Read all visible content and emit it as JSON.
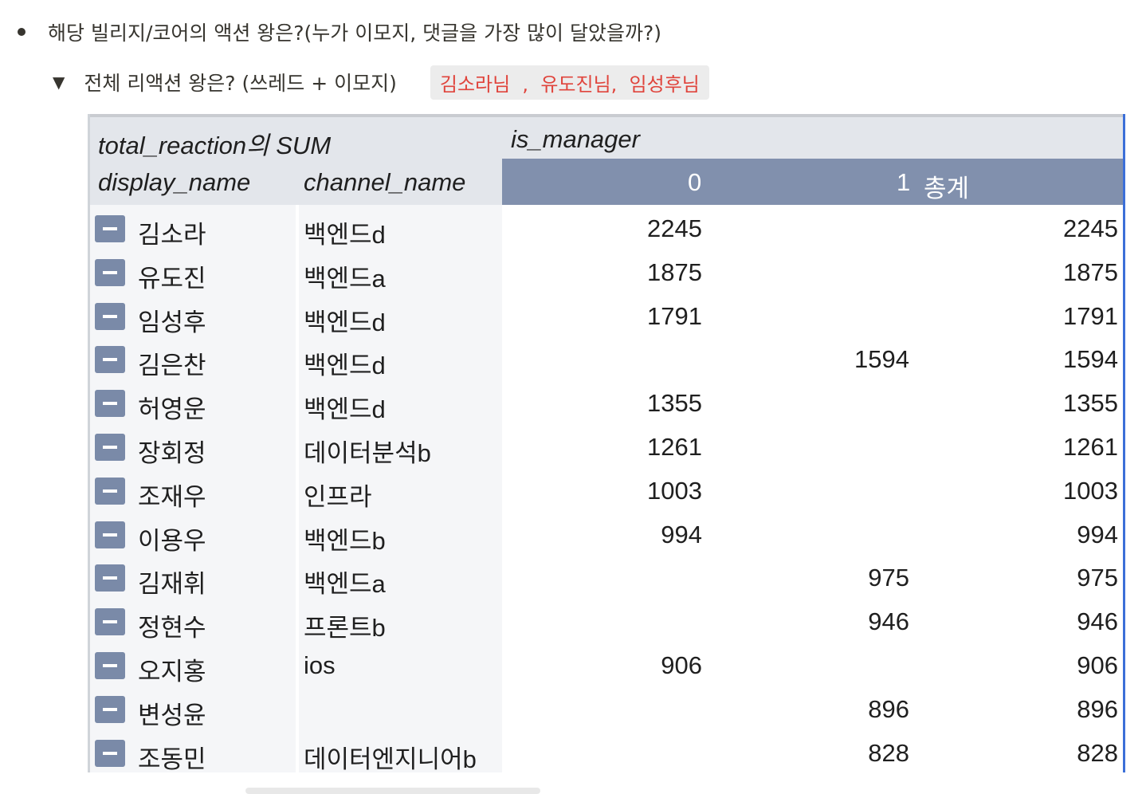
{
  "bullet": {
    "text": "해당 빌리지/코어의 액션 왕은?(누가 이모지, 댓글을 가장 많이 달았을까?)"
  },
  "toggle": {
    "arrow": "▼",
    "text": "전체 리액션 왕은? (쓰레드 + 이모지)",
    "highlight": "김소라님  ,  유도진님,  임성후님"
  },
  "pivot": {
    "header": {
      "measure": "total_reaction의 SUM",
      "column_field": "is_manager",
      "row_field_1": "display_name",
      "row_field_2": "channel_name",
      "col_0": "0",
      "col_1": "1",
      "col_total": "총계"
    },
    "rows": [
      {
        "name": "김소라",
        "channel": "백엔드d",
        "v0": "2245",
        "v1": "",
        "total": "2245"
      },
      {
        "name": "유도진",
        "channel": "백엔드a",
        "v0": "1875",
        "v1": "",
        "total": "1875"
      },
      {
        "name": "임성후",
        "channel": "백엔드d",
        "v0": "1791",
        "v1": "",
        "total": "1791"
      },
      {
        "name": "김은찬",
        "channel": "백엔드d",
        "v0": "",
        "v1": "1594",
        "total": "1594"
      },
      {
        "name": "허영운",
        "channel": "백엔드d",
        "v0": "1355",
        "v1": "",
        "total": "1355"
      },
      {
        "name": "장회정",
        "channel": "데이터분석b",
        "v0": "1261",
        "v1": "",
        "total": "1261"
      },
      {
        "name": "조재우",
        "channel": "인프라",
        "v0": "1003",
        "v1": "",
        "total": "1003"
      },
      {
        "name": "이용우",
        "channel": "백엔드b",
        "v0": "994",
        "v1": "",
        "total": "994"
      },
      {
        "name": "김재휘",
        "channel": "백엔드a",
        "v0": "",
        "v1": "975",
        "total": "975"
      },
      {
        "name": "정현수",
        "channel": "프론트b",
        "v0": "",
        "v1": "946",
        "total": "946"
      },
      {
        "name": "오지홍",
        "channel": "ios",
        "v0": "906",
        "v1": "",
        "total": "906"
      },
      {
        "name": "변성윤",
        "channel": "",
        "v0": "",
        "v1": "896",
        "total": "896"
      },
      {
        "name": "조동민",
        "channel": "데이터엔지니어b",
        "v0": "",
        "v1": "828",
        "total": "828"
      }
    ]
  }
}
